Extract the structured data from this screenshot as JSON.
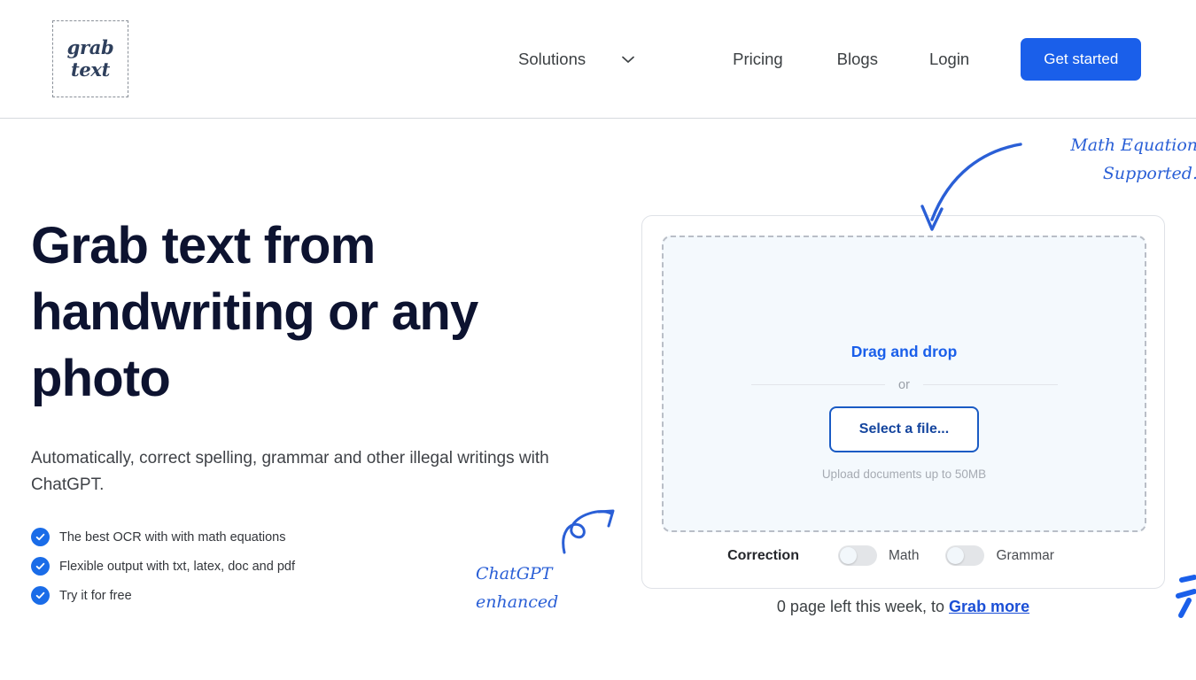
{
  "header": {
    "logo": {
      "line1": "grab",
      "line2": "text",
      "name": "grab text"
    },
    "nav": [
      {
        "label": "Solutions",
        "has_dropdown": true,
        "icon": "chevron-down-icon"
      },
      {
        "label": "Pricing",
        "has_dropdown": false
      },
      {
        "label": "Blogs",
        "has_dropdown": false
      },
      {
        "label": "Login",
        "has_dropdown": false
      }
    ],
    "cta": {
      "label": "Get started",
      "color": "#1a5fea"
    }
  },
  "hero": {
    "title": "Grab text from handwriting or any photo",
    "subtitle": "Automatically, correct spelling, grammar and other illegal writings with ChatGPT.",
    "features": [
      {
        "label": "The best OCR with with math equations",
        "icon": "check-circle-icon"
      },
      {
        "label": "Flexible output with txt, latex, doc and pdf",
        "icon": "check-circle-icon"
      },
      {
        "label": "Try it for free",
        "icon": "check-circle-icon"
      }
    ]
  },
  "upload": {
    "drag_title": "Drag and drop",
    "or_label": "or",
    "select_file_label": "Select a file...",
    "upload_hint": "Upload documents up to 50MB",
    "correction_label": "Correction",
    "toggles": [
      {
        "label": "Math",
        "state": "off"
      },
      {
        "label": "Grammar",
        "state": "off"
      }
    ],
    "pages_left_text": "0 page left this week, to ",
    "grab_more_label": "Grab more"
  },
  "annotations": {
    "math": "Math Equation Supported.",
    "math_line1": "Math Equation",
    "math_line2": "Supported.",
    "chatgpt_line1": "ChatGPT",
    "chatgpt_line2": "enhanced"
  },
  "colors": {
    "accent_blue": "#1a5fea",
    "annotation_blue": "#2a5fd6",
    "headline": "#0d1330",
    "dropzone_bg": "#f4f9fd"
  }
}
